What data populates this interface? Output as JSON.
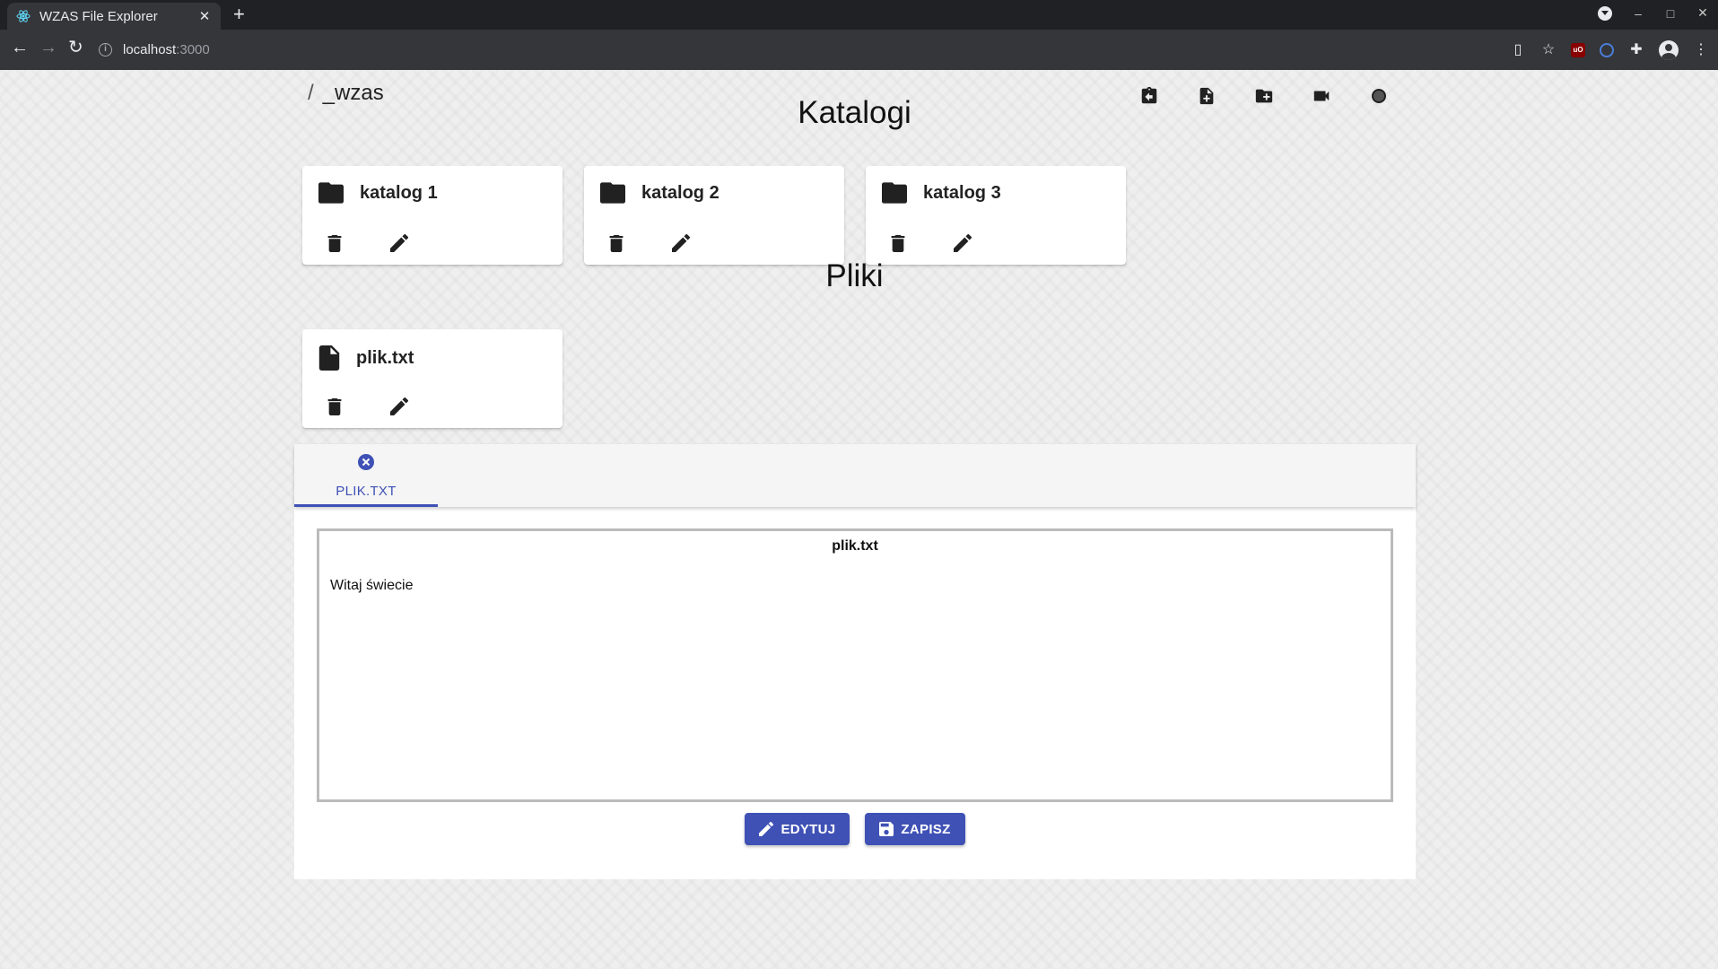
{
  "browser": {
    "tab_title": "WZAS File Explorer",
    "url_host": "localhost",
    "url_port": ":3000"
  },
  "breadcrumb": {
    "separator": "/",
    "current": "_wzas"
  },
  "sections": {
    "folders_title": "Katalogi",
    "files_title": "Pliki"
  },
  "folders": [
    {
      "name": "katalog 1",
      "icon": "folder-icon"
    },
    {
      "name": "katalog 2",
      "icon": "folder-icon"
    },
    {
      "name": "katalog 3",
      "icon": "folder-icon"
    }
  ],
  "files": [
    {
      "name": "plik.txt",
      "icon": "file-icon"
    }
  ],
  "editor": {
    "tab_label": "PLIK.TXT",
    "document_title": "plik.txt",
    "content": "Witaj świecie",
    "edit_label": "EDYTUJ",
    "save_label": "ZAPISZ"
  },
  "colors": {
    "accent": "#3f51b5",
    "icon": "#212121"
  }
}
